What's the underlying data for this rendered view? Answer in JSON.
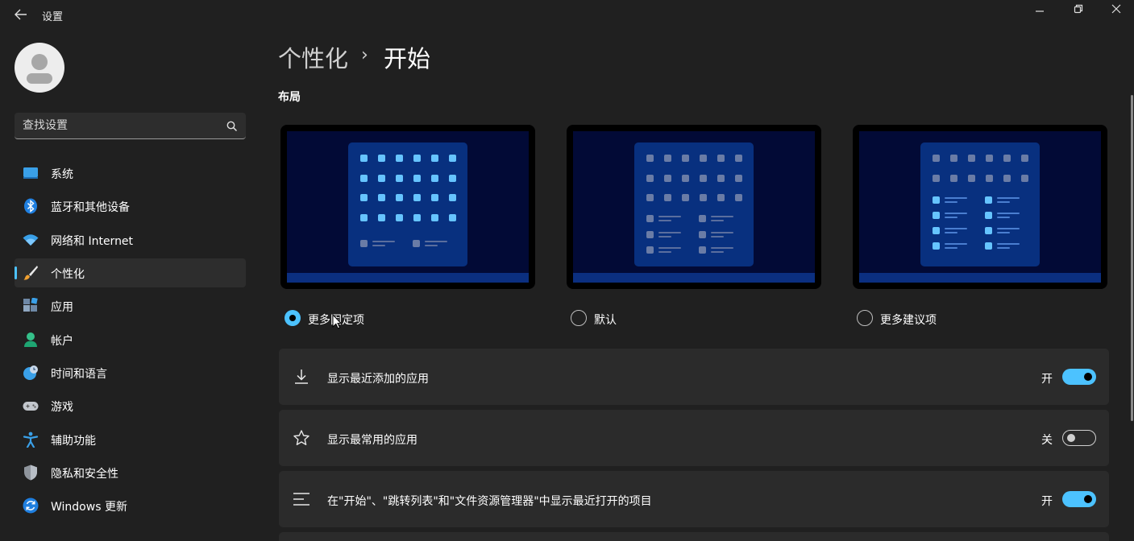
{
  "window": {
    "title": "设置",
    "controls": [
      "minimize",
      "restore",
      "close"
    ]
  },
  "sidebar": {
    "search": {
      "placeholder": "查找设置",
      "value": ""
    },
    "items": [
      {
        "label": "系统",
        "icon": "system-icon",
        "active": false
      },
      {
        "label": "蓝牙和其他设备",
        "icon": "bluetooth-icon",
        "active": false
      },
      {
        "label": "网络和 Internet",
        "icon": "wifi-icon",
        "active": false
      },
      {
        "label": "个性化",
        "icon": "brush-icon",
        "active": true
      },
      {
        "label": "应用",
        "icon": "apps-icon",
        "active": false
      },
      {
        "label": "帐户",
        "icon": "account-icon",
        "active": false
      },
      {
        "label": "时间和语言",
        "icon": "time-language-icon",
        "active": false
      },
      {
        "label": "游戏",
        "icon": "gamepad-icon",
        "active": false
      },
      {
        "label": "辅助功能",
        "icon": "accessibility-icon",
        "active": false
      },
      {
        "label": "隐私和安全性",
        "icon": "shield-icon",
        "active": false
      },
      {
        "label": "Windows 更新",
        "icon": "update-icon",
        "active": false
      }
    ]
  },
  "header": {
    "parent": "个性化",
    "separator": "›",
    "current": "开始"
  },
  "layout_section": {
    "title": "布局",
    "options": [
      {
        "label": "更多固定项",
        "selected": true
      },
      {
        "label": "默认",
        "selected": false
      },
      {
        "label": "更多建议项",
        "selected": false
      }
    ]
  },
  "settings": [
    {
      "label": "显示最近添加的应用",
      "state": "开",
      "on": true,
      "icon": "download-icon"
    },
    {
      "label": "显示最常用的应用",
      "state": "关",
      "on": false,
      "icon": "star-icon"
    },
    {
      "label": "在\"开始\"、\"跳转列表\"和\"文件资源管理器\"中显示最近打开的项目",
      "state": "开",
      "on": true,
      "icon": "list-icon"
    }
  ],
  "colors": {
    "background": "#202020",
    "card": "#2b2b2b",
    "accent": "#4cc2ff"
  }
}
